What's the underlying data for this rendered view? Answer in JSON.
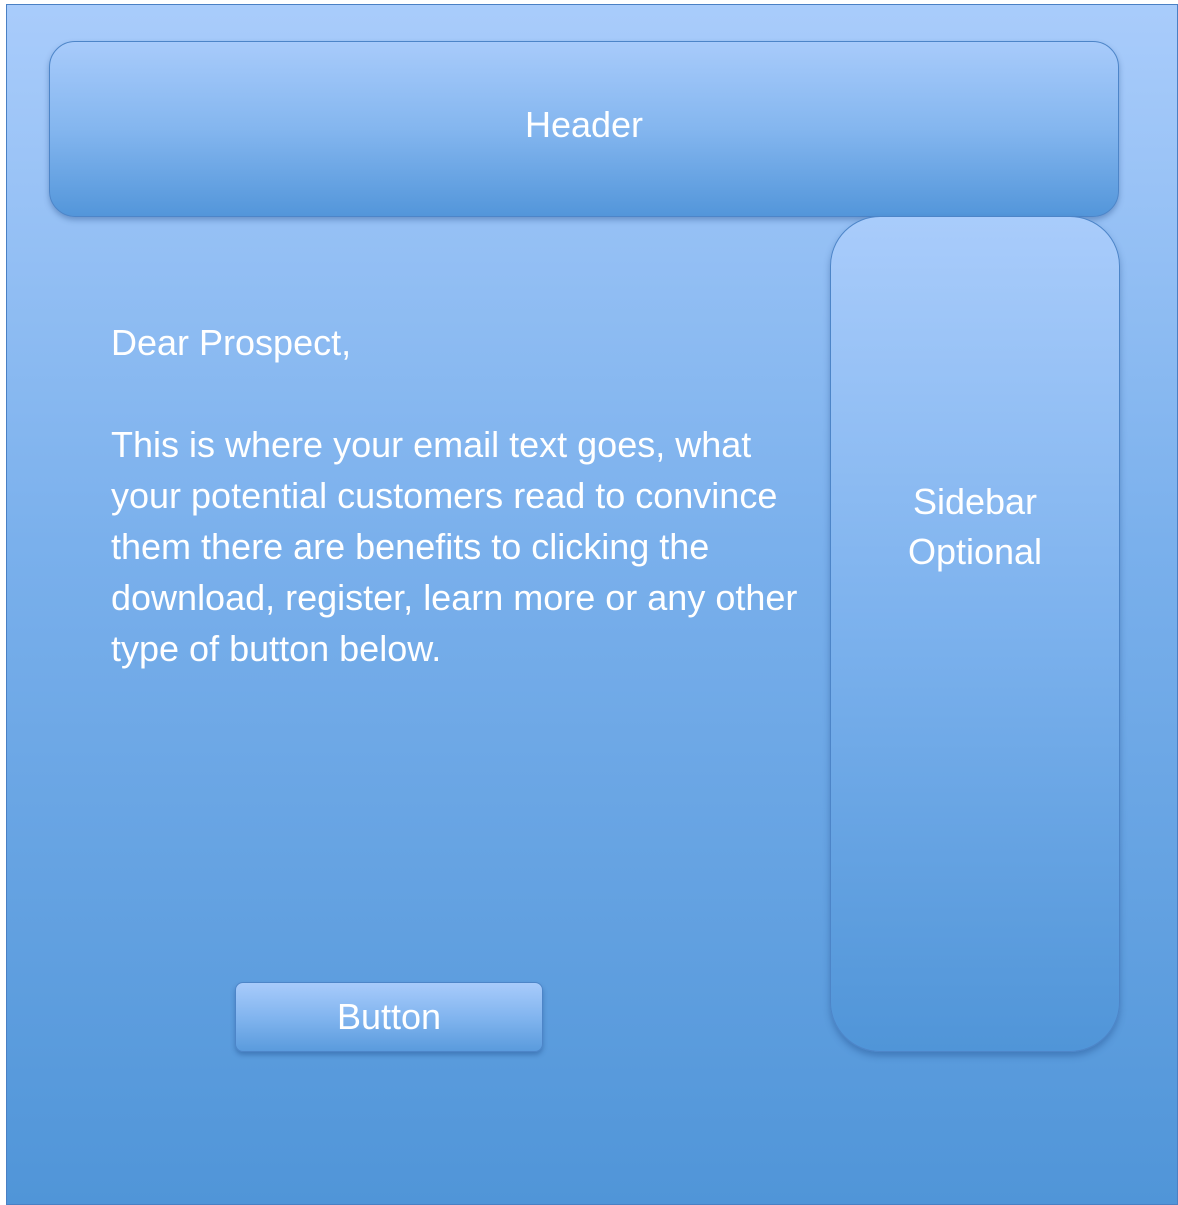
{
  "header": {
    "title": "Header"
  },
  "sidebar": {
    "line1": "Sidebar",
    "line2": "Optional"
  },
  "email": {
    "greeting": "Dear Prospect,",
    "body": "This is where your email text goes, what your potential customers read to convince them there are benefits to clicking the download, register, learn more or any other type of button below."
  },
  "cta": {
    "label": "Button"
  },
  "colors": {
    "background_top": "#a9ccfb",
    "background_bottom": "#5095d8",
    "text": "#ffffff"
  }
}
